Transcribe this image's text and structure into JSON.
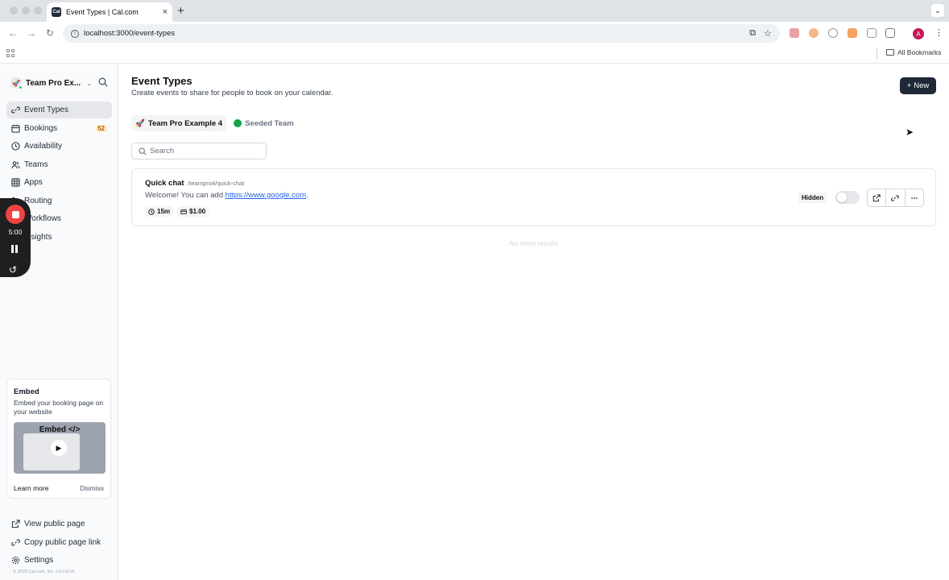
{
  "browser": {
    "tab_title": "Event Types | Cal.com",
    "tab_favicon_text": "Cal",
    "url": "localhost:3000/event-types",
    "bookmarks_label": "All Bookmarks",
    "profile_initial": "A"
  },
  "sidebar": {
    "team_name": "Team Pro Ex...",
    "nav": [
      {
        "label": "Event Types",
        "icon": "link-icon",
        "active": true
      },
      {
        "label": "Bookings",
        "icon": "calendar-icon",
        "badge": "52"
      },
      {
        "label": "Availability",
        "icon": "clock-icon"
      },
      {
        "label": "Teams",
        "icon": "users-icon"
      },
      {
        "label": "Apps",
        "icon": "grid-icon"
      },
      {
        "label": "Routing",
        "icon": "routing-icon"
      },
      {
        "label": "Workflows",
        "icon": "zap-icon"
      },
      {
        "label": "Insights",
        "icon": "chart-icon"
      }
    ],
    "embed": {
      "title": "Embed",
      "description": "Embed your booking page on your website",
      "thumb_label": "Embed </>",
      "learn_more": "Learn more",
      "dismiss": "Dismiss"
    },
    "bottom_nav": [
      {
        "label": "View public page",
        "icon": "external-link-icon"
      },
      {
        "label": "Copy public page link",
        "icon": "copy-icon"
      },
      {
        "label": "Settings",
        "icon": "settings-icon"
      }
    ],
    "copyright": "© 2025 Cal.com, Inc. v.5.0.8-sh"
  },
  "recorder": {
    "time": "5:00"
  },
  "main": {
    "title": "Event Types",
    "subtitle": "Create events to share for people to book on your calendar.",
    "new_button": "New",
    "team_tabs": [
      {
        "label": "Team Pro Example 4",
        "active": true
      },
      {
        "label": "Seeded Team",
        "active": false
      }
    ],
    "search_placeholder": "Search",
    "events": [
      {
        "title": "Quick chat",
        "slug": "/teampro4/quick-chat",
        "description_prefix": "Welcome! You can add ",
        "description_link": "https://www.google.com",
        "description_suffix": ".",
        "duration": "15m",
        "price": "$1.00",
        "hidden_label": "Hidden",
        "enabled": false
      }
    ],
    "no_more": "No more results"
  },
  "colors": {
    "primary_button": "#1f2937",
    "link": "#2563eb",
    "badge_bg": "#fef3c7",
    "badge_text": "#b45309",
    "recorder_stop": "#ef4444"
  }
}
